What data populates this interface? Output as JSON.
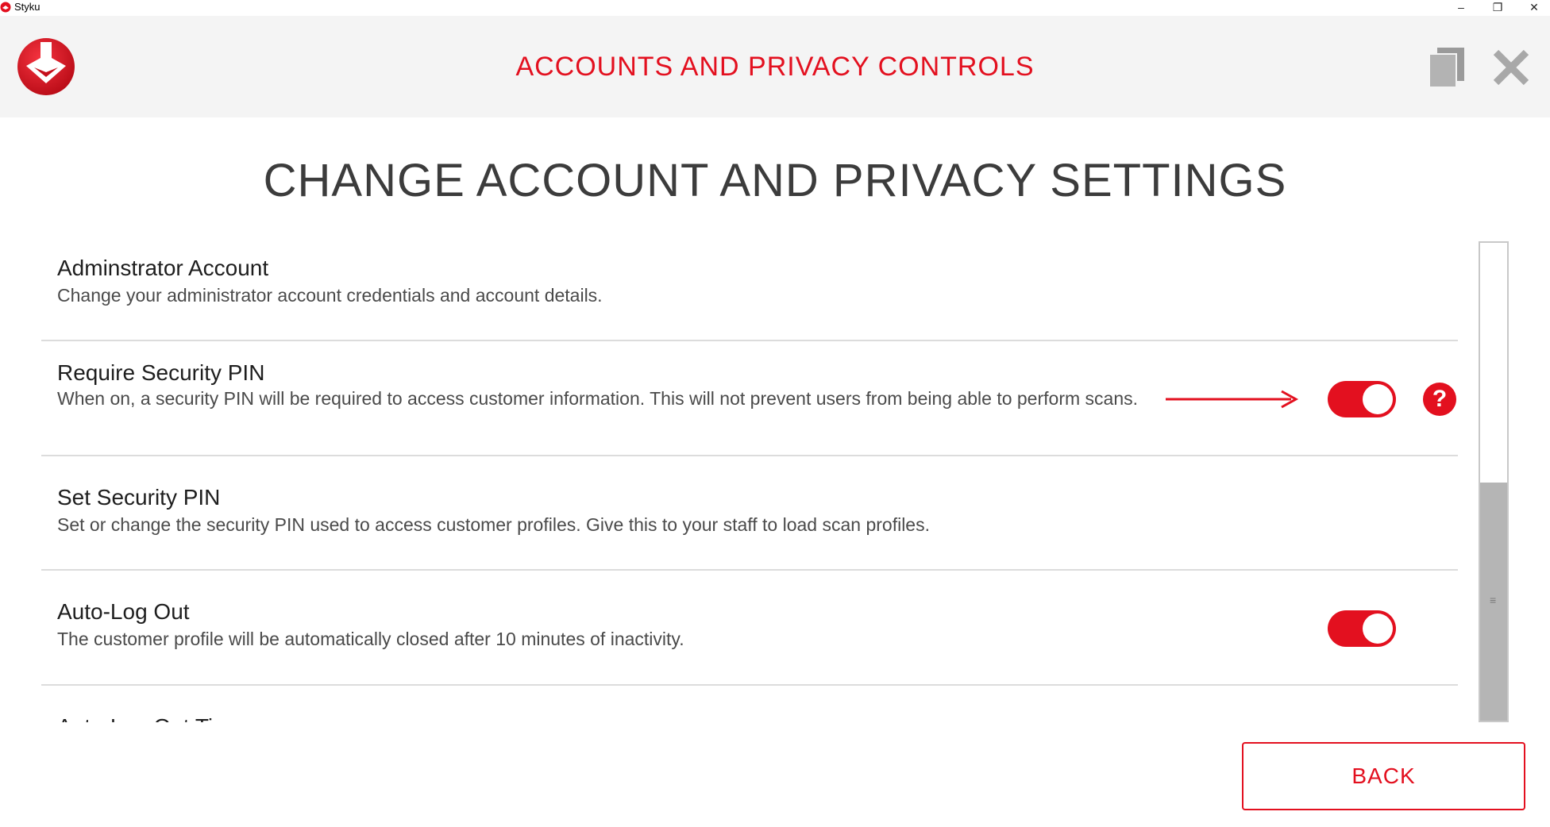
{
  "window": {
    "title": "Styku",
    "minimize_glyph": "–",
    "restore_glyph": "❐",
    "close_glyph": "✕"
  },
  "header": {
    "title": "ACCOUNTS AND PRIVACY CONTROLS",
    "logo_icon": "styku-logo-icon",
    "copy_icon": "copy-icon",
    "close_icon": "close-icon"
  },
  "page": {
    "title": "CHANGE ACCOUNT AND PRIVACY SETTINGS"
  },
  "settings": [
    {
      "title": "Adminstrator Account",
      "description": "Change your administrator account credentials and account details."
    },
    {
      "title": "Require Security PIN",
      "description": "When on, a security PIN will be required to access customer information. This will not prevent users from being able to perform scans.",
      "toggle": "on",
      "help_label": "?"
    },
    {
      "title": "Set Security PIN",
      "description": "Set or change the security PIN used to access customer profiles. Give this to your staff to load scan profiles."
    },
    {
      "title": "Auto-Log Out",
      "description": "The customer profile will be automatically closed after 10 minutes of inactivity.",
      "toggle": "on"
    },
    {
      "title": "Auto-Log Out Ti"
    }
  ],
  "actions": {
    "back_label": "BACK"
  },
  "colors": {
    "accent": "#e3101f",
    "header_bg": "#f4f4f4",
    "divider": "#dcdcdc"
  }
}
